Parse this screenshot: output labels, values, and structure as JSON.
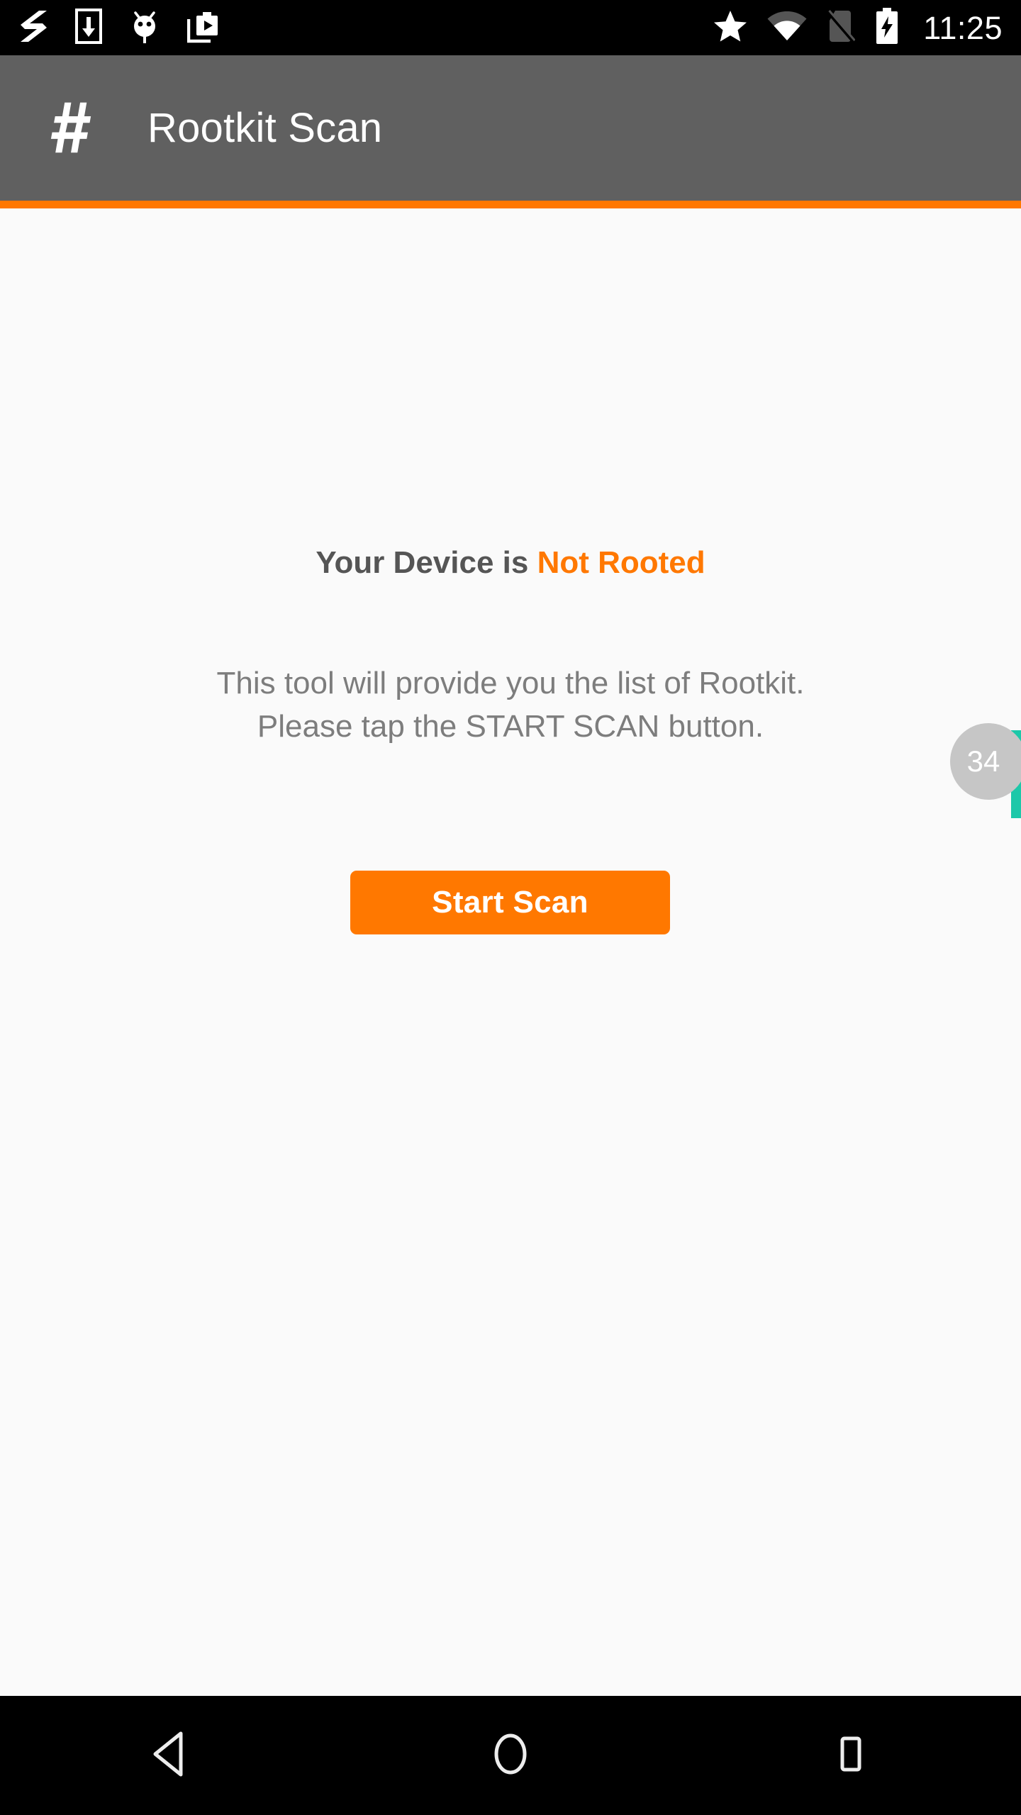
{
  "status_bar": {
    "notification_icons": [
      {
        "name": "app-logo-icon",
        "label": "zigzag-ribbon"
      },
      {
        "name": "download-to-device-icon",
        "label": "download"
      },
      {
        "name": "android-bug-icon",
        "label": "android-head"
      },
      {
        "name": "media-library-icon",
        "label": "video-library"
      }
    ],
    "system_icons": [
      {
        "name": "star-icon",
        "label": "starred"
      },
      {
        "name": "wifi-icon",
        "label": "wifi"
      },
      {
        "name": "no-sim-icon",
        "label": "no-sim"
      },
      {
        "name": "battery-charging-icon",
        "label": "battery-charging"
      }
    ],
    "clock": "11:25",
    "background_color": "#000000",
    "foreground_color": "#FFFFFF"
  },
  "app_bar": {
    "icon": "hash-icon",
    "title": "Rootkit Scan",
    "background_color": "#606060",
    "accent_color": "#FF7800",
    "title_color": "#FFFFFF"
  },
  "main": {
    "status_line": {
      "prefix": "Your Device is ",
      "value": "Not Rooted",
      "prefix_color": "#555555",
      "value_color": "#FF7800"
    },
    "description_lines": [
      "This tool will provide you the list of Rootkit.",
      "Please tap the START SCAN button."
    ],
    "description_color": "#7D7D7D",
    "start_scan_label": "Start Scan",
    "button_color": "#FF7800",
    "button_text_color": "#FFFFFF",
    "background_color": "#FAFAFA"
  },
  "scrollbar": {
    "fastscroll_value": "34",
    "thumb_color": "#1DC8A9",
    "badge_color": "#C6C6C6",
    "badge_text_color": "#FFFFFF"
  },
  "nav_bar": {
    "buttons": [
      {
        "name": "nav-back-button",
        "label": "Back"
      },
      {
        "name": "nav-home-button",
        "label": "Home"
      },
      {
        "name": "nav-recents-button",
        "label": "Recents"
      }
    ],
    "background_color": "#000000"
  }
}
